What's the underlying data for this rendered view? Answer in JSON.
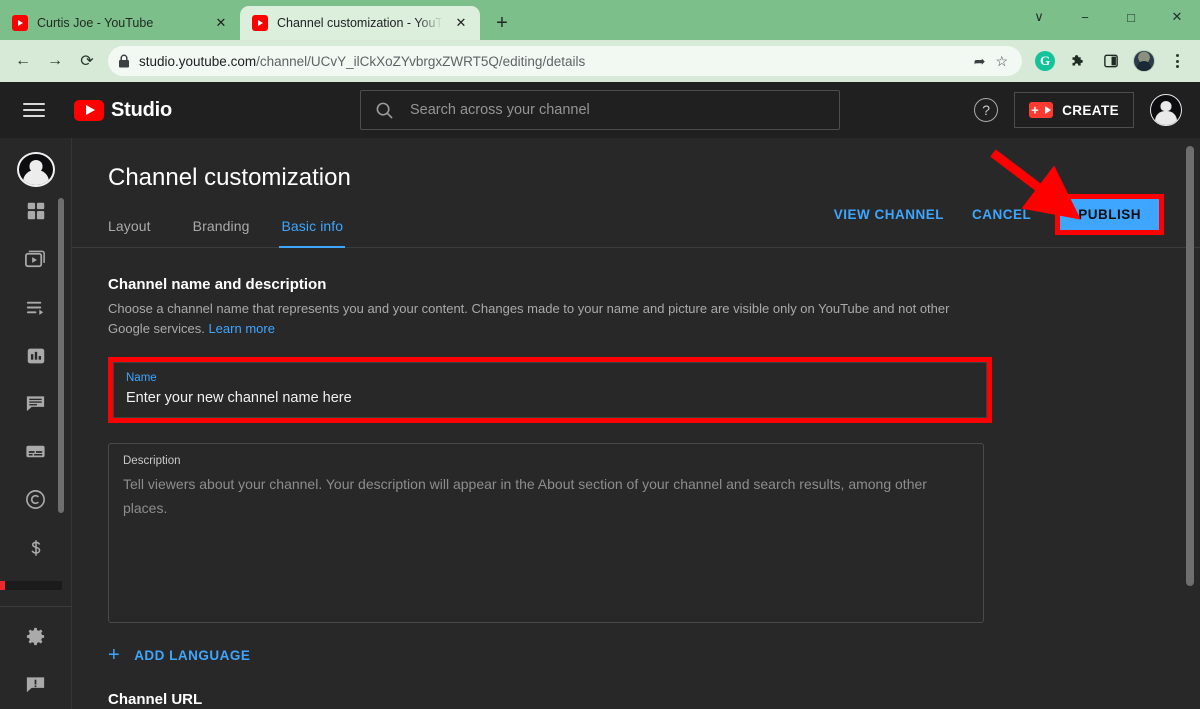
{
  "browser": {
    "tabs": [
      {
        "title": "Curtis Joe - YouTube",
        "active": false,
        "favicon": "youtube-icon"
      },
      {
        "title": "Channel customization - YouTub",
        "active": true,
        "favicon": "youtube-icon"
      }
    ],
    "new_tab_label": "+",
    "window_controls": {
      "minimize_all": "∨",
      "minimize": "−",
      "maximize": "□",
      "close": "✕"
    },
    "nav": {
      "back": "←",
      "forward": "→",
      "reload": "⟳"
    },
    "omnibox": {
      "lock_icon": "lock-icon",
      "url_domain": "studio.youtube.com",
      "url_path": "/channel/UCvY_ilCkXoZYvbrgxZWRT5Q/editing/details",
      "share_icon": "share-icon",
      "bookmark_icon": "star-icon"
    },
    "extensions": [
      {
        "name": "grammarly-icon",
        "glyph": "G",
        "color": "#15C39A"
      },
      {
        "name": "puzzle-icon",
        "glyph": "❖"
      },
      {
        "name": "sidepanel-icon",
        "glyph": "■"
      }
    ],
    "profile_icon": "profile-avatar",
    "menu_icon": "three-dots-icon"
  },
  "studio": {
    "header": {
      "menu_icon": "hamburger-menu-icon",
      "logo_text": "Studio",
      "logo_icon": "youtube-play-icon",
      "search": {
        "placeholder": "Search across your channel",
        "icon": "search-icon"
      },
      "help_icon": "help-question-icon",
      "create_label": "CREATE",
      "create_icon": "video-camera-plus-icon",
      "account_avatar": "account-avatar"
    },
    "sidebar": {
      "avatar": "channel-avatar",
      "items": [
        {
          "name": "dashboard",
          "icon": "dashboard-grid-icon"
        },
        {
          "name": "content",
          "icon": "video-content-icon"
        },
        {
          "name": "playlists",
          "icon": "playlists-icon"
        },
        {
          "name": "analytics",
          "icon": "analytics-bar-chart-icon"
        },
        {
          "name": "comments",
          "icon": "comments-icon"
        },
        {
          "name": "subtitles",
          "icon": "subtitles-icon"
        },
        {
          "name": "copyright",
          "icon": "copyright-icon"
        },
        {
          "name": "earn",
          "icon": "dollar-monetization-icon"
        }
      ],
      "footer_items": [
        {
          "name": "settings",
          "icon": "gear-settings-icon"
        },
        {
          "name": "send-feedback",
          "icon": "feedback-warning-icon"
        }
      ]
    },
    "main": {
      "page_title": "Channel customization",
      "tabs": [
        {
          "label": "Layout",
          "selected": false
        },
        {
          "label": "Branding",
          "selected": false
        },
        {
          "label": "Basic info",
          "selected": true
        }
      ],
      "actions": {
        "view_channel": "VIEW CHANNEL",
        "cancel": "CANCEL",
        "publish": "PUBLISH"
      },
      "section": {
        "title": "Channel name and description",
        "description": "Choose a channel name that represents you and your content. Changes made to your name and picture are visible only on YouTube and not other Google services.",
        "learn_more": "Learn more"
      },
      "name_field": {
        "label": "Name",
        "value": "Enter your new channel name here"
      },
      "description_field": {
        "label": "Description",
        "placeholder": "Tell viewers about your channel. Your description will appear in the About section of your channel and search results, among other places."
      },
      "add_language": {
        "label": "ADD LANGUAGE",
        "icon": "plus-icon"
      },
      "next_section_title": "Channel URL"
    }
  },
  "annotations": {
    "highlight_color": "#FF0000",
    "arrow": "red-arrow-pointing-to-publish",
    "boxes": [
      "publish-button-highlight",
      "name-field-highlight"
    ]
  },
  "colors": {
    "browser_frame": "#7DBF8B",
    "toolbar": "#D6EAD7",
    "studio_bg": "#282828",
    "studio_header": "#202020",
    "accent_blue": "#3EA6FF",
    "youtube_red": "#FF0000"
  }
}
